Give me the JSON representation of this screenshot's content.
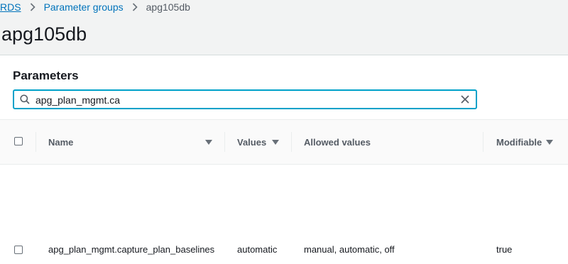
{
  "breadcrumb": {
    "items": [
      {
        "label": "RDS"
      },
      {
        "label": "Parameter groups"
      }
    ],
    "current": "apg105db"
  },
  "page": {
    "title": "apg105db"
  },
  "parameters": {
    "title": "Parameters",
    "search": {
      "value": "apg_plan_mgmt.ca",
      "icon": "search-icon",
      "clear_icon": "close-icon"
    },
    "columns": [
      {
        "label": "Name",
        "sortable": true
      },
      {
        "label": "Values",
        "sortable": true
      },
      {
        "label": "Allowed values",
        "sortable": false
      },
      {
        "label": "Modifiable",
        "sortable": true
      }
    ],
    "rows": [
      {
        "name": "apg_plan_mgmt.capture_plan_baselines",
        "value": "automatic",
        "allowed_values": "manual, automatic, off",
        "modifiable": "true"
      }
    ]
  },
  "colors": {
    "link": "#0073bb",
    "focus": "#00a1c9",
    "background": "#f2f3f3"
  }
}
